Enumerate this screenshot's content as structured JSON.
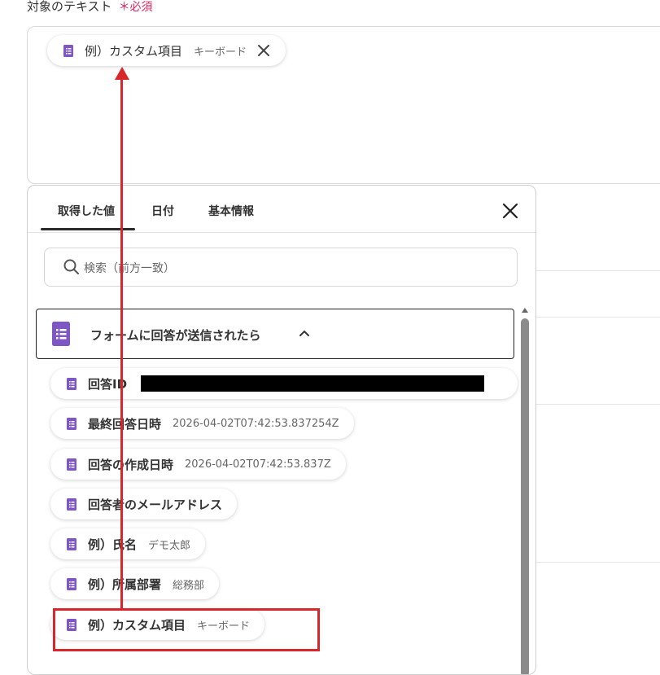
{
  "field": {
    "label": "対象のテキスト",
    "required": "＊必須"
  },
  "selected_chip": {
    "label": "例）カスタム項目",
    "sub": "キーボード"
  },
  "panel": {
    "tabs": [
      "取得した値",
      "日付",
      "基本情報"
    ],
    "search_placeholder": "検索（前方一致）",
    "section_title": "フォームに回答が送信されたら",
    "items": [
      {
        "label": "回答ID",
        "sub": ""
      },
      {
        "label": "最終回答日時",
        "sub": "2026-04-02T07:42:53.837254Z"
      },
      {
        "label": "回答の作成日時",
        "sub": "2026-04-02T07:42:53.837Z"
      },
      {
        "label": "回答者のメールアドレス",
        "sub": ""
      },
      {
        "label": "例）氏名",
        "sub": "デモ太郎"
      },
      {
        "label": "例）所属部署",
        "sub": "総務部"
      },
      {
        "label": "例）カスタム項目",
        "sub": "キーボード"
      }
    ]
  },
  "colors": {
    "accent_red": "#d9262b",
    "icon_purple": "#7e57c2",
    "required_pink": "#e0245e"
  }
}
